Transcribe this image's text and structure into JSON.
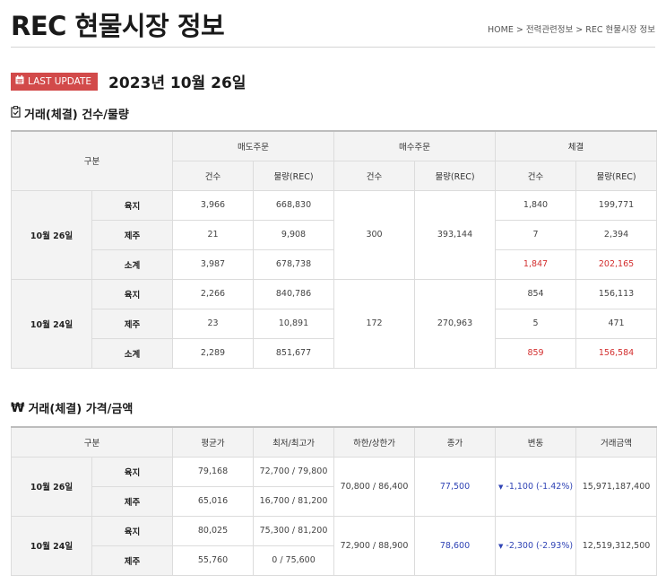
{
  "header": {
    "title": "REC 현물시장 정보",
    "breadcrumb": "HOME > 전력관련정보 > REC 현물시장 정보"
  },
  "last_update": {
    "badge_label": "LAST UPDATE",
    "badge_icon": "calendar-icon",
    "date": "2023년 10월 26일"
  },
  "colors": {
    "badge": "#d24a4a",
    "highlight_red": "#d32f2f",
    "highlight_blue": "#3044b5"
  },
  "volume_section": {
    "title": "거래(체결) 건수/물량",
    "icon": "clipboard-check-icon",
    "headers": {
      "category": "구분",
      "sell_orders": "매도주문",
      "buy_orders": "매수주문",
      "settled": "체결",
      "count": "건수",
      "volume": "물량(REC)"
    },
    "groups": [
      {
        "date": "10월 26일",
        "buy_count": "300",
        "buy_volume": "393,144",
        "rows": [
          {
            "region": "육지",
            "sell_count": "3,966",
            "sell_volume": "668,830",
            "settled_count": "1,840",
            "settled_volume": "199,771"
          },
          {
            "region": "제주",
            "sell_count": "21",
            "sell_volume": "9,908",
            "settled_count": "7",
            "settled_volume": "2,394"
          },
          {
            "region": "소계",
            "sell_count": "3,987",
            "sell_volume": "678,738",
            "settled_count": "1,847",
            "settled_volume": "202,165"
          }
        ]
      },
      {
        "date": "10월 24일",
        "buy_count": "172",
        "buy_volume": "270,963",
        "rows": [
          {
            "region": "육지",
            "sell_count": "2,266",
            "sell_volume": "840,786",
            "settled_count": "854",
            "settled_volume": "156,113"
          },
          {
            "region": "제주",
            "sell_count": "23",
            "sell_volume": "10,891",
            "settled_count": "5",
            "settled_volume": "471"
          },
          {
            "region": "소계",
            "sell_count": "2,289",
            "sell_volume": "851,677",
            "settled_count": "859",
            "settled_volume": "156,584"
          }
        ]
      }
    ]
  },
  "price_section": {
    "title": "거래(체결) 가격/금액",
    "icon": "won-icon",
    "icon_glyph": "₩",
    "headers": {
      "category": "구분",
      "avg_price": "평균가",
      "min_max": "최저/최고가",
      "limit": "하한/상한가",
      "close": "종가",
      "change": "변동",
      "amount": "거래금액"
    },
    "groups": [
      {
        "date": "10월 26일",
        "limit": "70,800 / 86,400",
        "close": "77,500",
        "change": "-1,100 (-1.42%)",
        "change_icon": "down-triangle-icon",
        "amount": "15,971,187,400",
        "rows": [
          {
            "region": "육지",
            "avg": "79,168",
            "min_max": "72,700 / 79,800"
          },
          {
            "region": "제주",
            "avg": "65,016",
            "min_max": "16,700 / 81,200"
          }
        ]
      },
      {
        "date": "10월 24일",
        "limit": "72,900 / 88,900",
        "close": "78,600",
        "change": "-2,300 (-2.93%)",
        "change_icon": "down-triangle-icon",
        "amount": "12,519,312,500",
        "rows": [
          {
            "region": "육지",
            "avg": "80,025",
            "min_max": "75,300 / 81,200"
          },
          {
            "region": "제주",
            "avg": "55,760",
            "min_max": "0 / 75,600"
          }
        ]
      }
    ]
  }
}
